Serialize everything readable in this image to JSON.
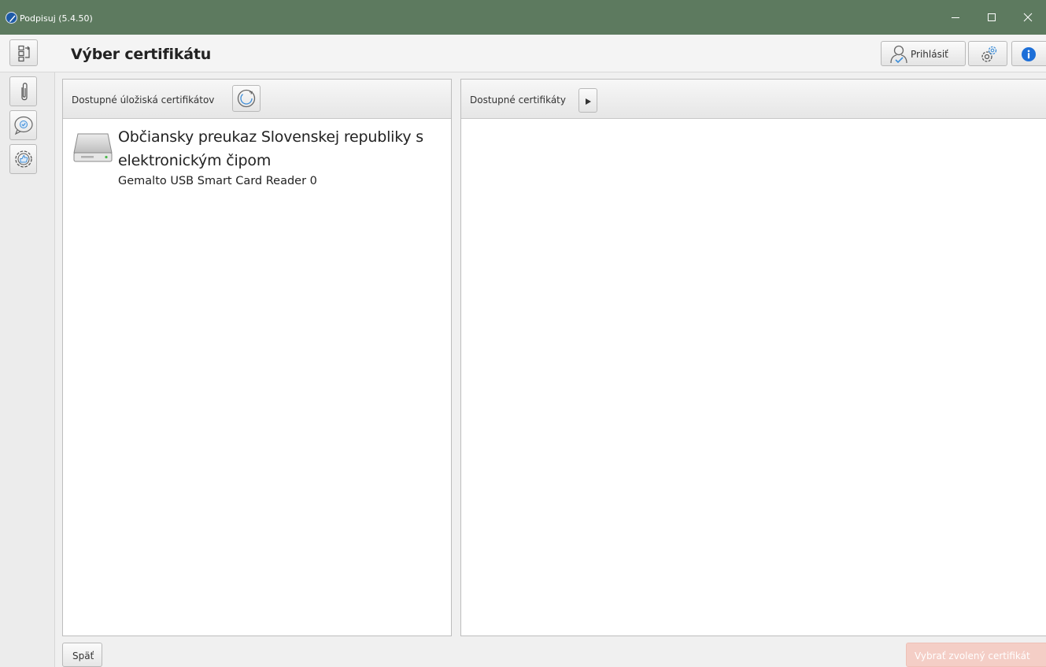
{
  "window": {
    "title": "Podpisuj (5.4.50)",
    "app_icon": "feather-pen-icon",
    "controls": [
      "minimize-icon",
      "maximize-icon",
      "close-icon"
    ],
    "titlebar_color": "#5d7a5f"
  },
  "header": {
    "page_title": "Výber certifikátu",
    "toggle_icon": "panel-toggle-icon",
    "login_label": "Prihlásiť",
    "login_icon": "user-icon",
    "settings_icon": "gear-icon",
    "info_icon": "info-icon",
    "info_color": "#1d6fd8"
  },
  "sidebar": {
    "items": [
      {
        "name": "attachment",
        "icon": "paperclip-icon"
      },
      {
        "name": "verify",
        "icon": "check-bubble-icon"
      },
      {
        "name": "sign",
        "icon": "thumbs-up-gear-icon"
      }
    ]
  },
  "stores_panel": {
    "header_label": "Dostupné úložiská certifikátov",
    "refresh_icon": "refresh-icon",
    "items": [
      {
        "name": "Občiansky preukaz Slovenskej republiky s elektronickým čipom",
        "reader": "Gemalto USB Smart Card Reader 0",
        "icon": "drive-icon"
      }
    ]
  },
  "certs_panel": {
    "header_label": "Dostupné certifikáty",
    "expand_icon": "play-arrow-icon"
  },
  "footer": {
    "back_label": "Späť",
    "select_label": "Vybrať zvolený certifikát",
    "select_color": "#f4cec6"
  }
}
